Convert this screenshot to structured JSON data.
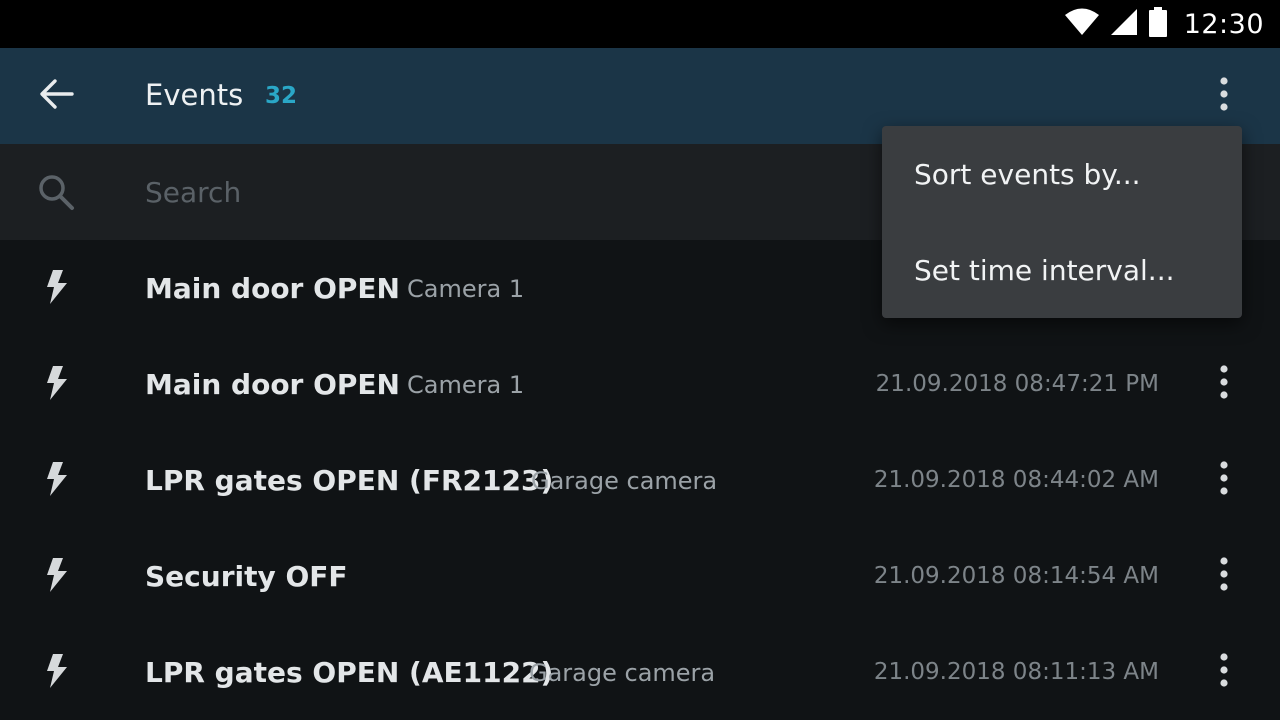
{
  "status_bar": {
    "time": "12:30",
    "icons": [
      "wifi-icon",
      "signal-icon",
      "battery-icon"
    ]
  },
  "app_bar": {
    "title": "Events",
    "count": "32",
    "back_icon": "arrow-back-icon",
    "overflow_icon": "more-vertical-icon"
  },
  "search": {
    "placeholder": "Search",
    "value": "",
    "icon": "search-icon"
  },
  "colors": {
    "app_bar_bg": "#1b3547",
    "accent": "#2aa7c7",
    "list_bg": "#101315",
    "menu_bg": "#3a3d40"
  },
  "events": [
    {
      "icon": "lightning-icon",
      "title": "Main door OPEN",
      "camera": "Camera 1",
      "time": ""
    },
    {
      "icon": "lightning-icon",
      "title": "Main door OPEN",
      "camera": "Camera 1",
      "time": "21.09.2018 08:47:21 PM"
    },
    {
      "icon": "lightning-icon",
      "title": "LPR gates OPEN (FR2123)",
      "camera": "Garage camera",
      "time": "21.09.2018 08:44:02 AM"
    },
    {
      "icon": "lightning-icon",
      "title": "Security OFF",
      "camera": "",
      "time": "21.09.2018 08:14:54 AM"
    },
    {
      "icon": "lightning-icon",
      "title": "LPR gates OPEN (AE1122)",
      "camera": "Garage camera",
      "time": "21.09.2018 08:11:13 AM"
    }
  ],
  "menu": {
    "items": [
      {
        "label": "Sort events by..."
      },
      {
        "label": "Set time interval..."
      }
    ]
  }
}
